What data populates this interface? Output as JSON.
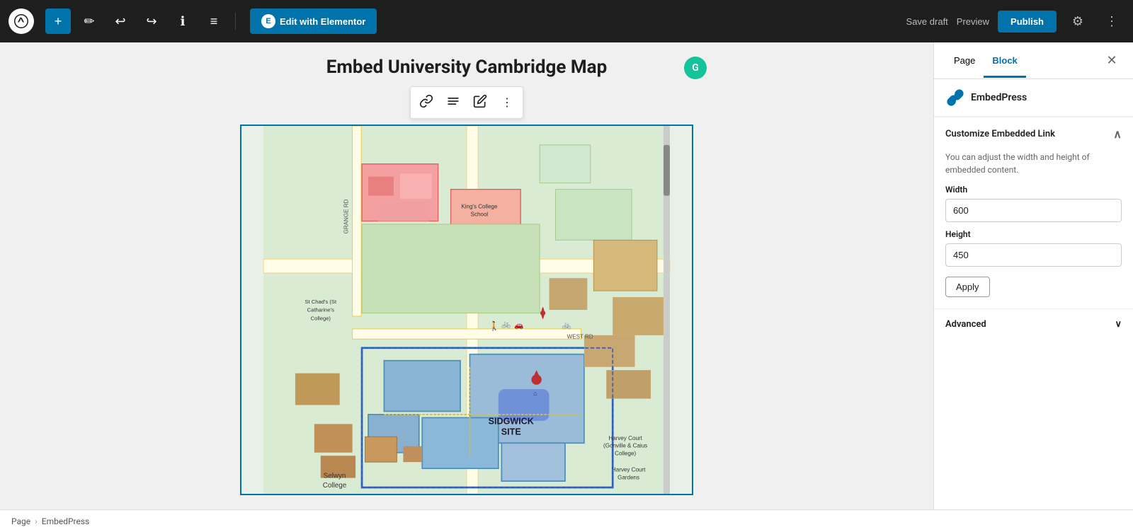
{
  "topbar": {
    "add_label": "+",
    "edit_elementor_label": "Edit with Elementor",
    "elementor_logo": "E",
    "undo_label": "↩",
    "redo_label": "↪",
    "info_label": "ℹ",
    "list_label": "≡",
    "save_draft_label": "Save draft",
    "preview_label": "Preview",
    "publish_label": "Publish"
  },
  "editor": {
    "page_title": "Embed University Cambridge Map"
  },
  "block_toolbar": {
    "link_btn": "🔗",
    "align_btn": "≡",
    "edit_btn": "✎",
    "more_btn": "⋮"
  },
  "right_panel": {
    "tab_page": "Page",
    "tab_block": "Block",
    "plugin_name": "EmbedPress",
    "customize_section": {
      "title": "Customize Embedded Link",
      "description": "You can adjust the width and height of embedded content.",
      "width_label": "Width",
      "width_value": "600",
      "height_label": "Height",
      "height_value": "450",
      "apply_label": "Apply"
    },
    "advanced_section": {
      "title": "Advanced"
    }
  },
  "breadcrumb": {
    "page_label": "Page",
    "separator": "›",
    "plugin_label": "EmbedPress"
  }
}
